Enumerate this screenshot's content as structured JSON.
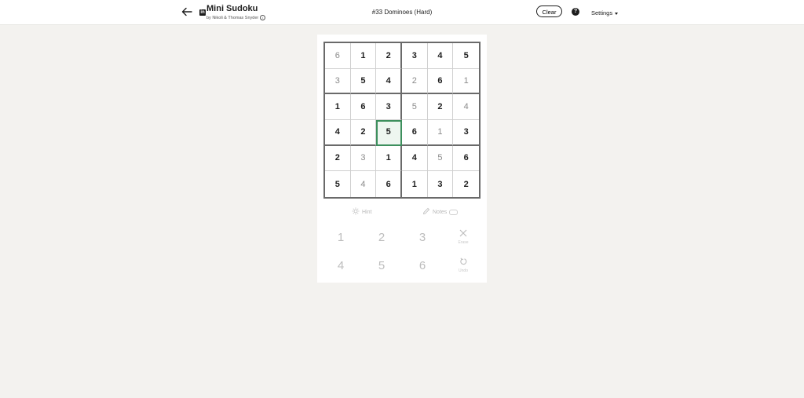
{
  "header": {
    "app_title": "Mini Sudoku",
    "byline": "by Nikoli & Thomas Snyder",
    "puzzle_title": "#33 Dominoes (Hard)",
    "clear_label": "Clear",
    "settings_label": "Settings",
    "badge": "in",
    "help_glyph": "?",
    "info_glyph": "i"
  },
  "board": {
    "selected": [
      3,
      2
    ],
    "rows": [
      [
        {
          "v": "6",
          "t": "user"
        },
        {
          "v": "1",
          "t": "given"
        },
        {
          "v": "2",
          "t": "given"
        },
        {
          "v": "3",
          "t": "given"
        },
        {
          "v": "4",
          "t": "given"
        },
        {
          "v": "5",
          "t": "given"
        }
      ],
      [
        {
          "v": "3",
          "t": "user"
        },
        {
          "v": "5",
          "t": "given"
        },
        {
          "v": "4",
          "t": "given"
        },
        {
          "v": "2",
          "t": "user"
        },
        {
          "v": "6",
          "t": "given"
        },
        {
          "v": "1",
          "t": "user"
        }
      ],
      [
        {
          "v": "1",
          "t": "given"
        },
        {
          "v": "6",
          "t": "given"
        },
        {
          "v": "3",
          "t": "given"
        },
        {
          "v": "5",
          "t": "user"
        },
        {
          "v": "2",
          "t": "given"
        },
        {
          "v": "4",
          "t": "user"
        }
      ],
      [
        {
          "v": "4",
          "t": "given"
        },
        {
          "v": "2",
          "t": "given"
        },
        {
          "v": "5",
          "t": "given"
        },
        {
          "v": "6",
          "t": "given"
        },
        {
          "v": "1",
          "t": "user"
        },
        {
          "v": "3",
          "t": "given"
        }
      ],
      [
        {
          "v": "2",
          "t": "given"
        },
        {
          "v": "3",
          "t": "user"
        },
        {
          "v": "1",
          "t": "given"
        },
        {
          "v": "4",
          "t": "given"
        },
        {
          "v": "5",
          "t": "user"
        },
        {
          "v": "6",
          "t": "given"
        }
      ],
      [
        {
          "v": "5",
          "t": "given"
        },
        {
          "v": "4",
          "t": "user"
        },
        {
          "v": "6",
          "t": "given"
        },
        {
          "v": "1",
          "t": "given"
        },
        {
          "v": "3",
          "t": "given"
        },
        {
          "v": "2",
          "t": "given"
        }
      ]
    ]
  },
  "tools": {
    "hint_label": "Hint",
    "notes_label": "Notes"
  },
  "keypad": {
    "numbers": [
      "1",
      "2",
      "3",
      "4",
      "5",
      "6"
    ],
    "erase_label": "Erase",
    "undo_label": "Undo"
  },
  "colors": {
    "background": "#f3f2ef",
    "selected_border": "#3d8f5d",
    "given_text": "#1d1d1d",
    "user_text": "#8a8a8a",
    "disabled": "#bdbdbd"
  }
}
